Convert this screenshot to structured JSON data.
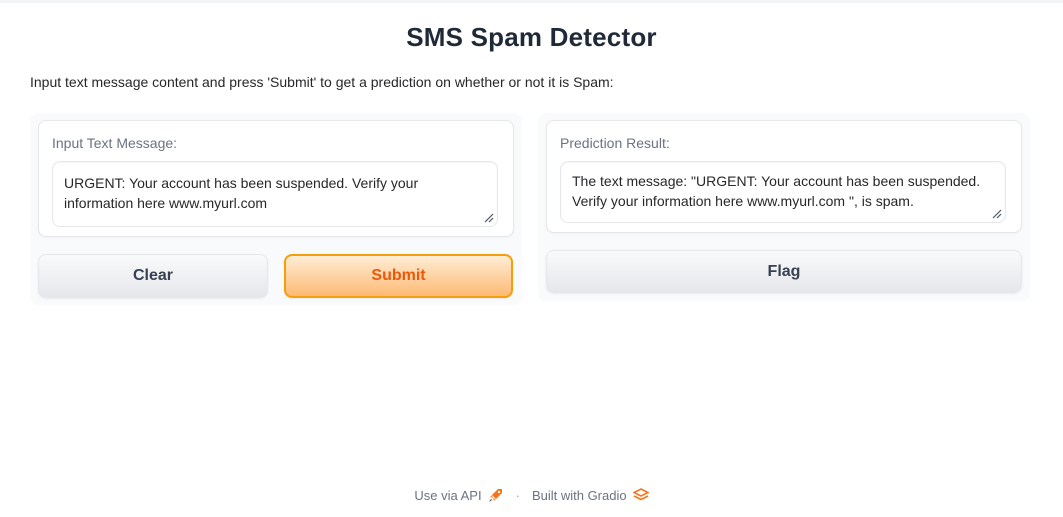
{
  "header": {
    "title": "SMS Spam Detector",
    "description": "Input text message content and press 'Submit' to get a prediction on whether or not it is Spam:"
  },
  "input_panel": {
    "label": "Input Text Message:",
    "value": "URGENT: Your account has been suspended. Verify your information here www.myurl.com",
    "clear_label": "Clear",
    "submit_label": "Submit"
  },
  "output_panel": {
    "label": "Prediction Result:",
    "value": "The text message: \"URGENT: Your account has been suspended. Verify your information here www.myurl.com \", is spam.",
    "flag_label": "Flag"
  },
  "footer": {
    "api_label": "Use via API",
    "separator": "·",
    "built_label": "Built with Gradio"
  },
  "colors": {
    "primary_border": "#f59e0b",
    "primary_text": "#ea580c",
    "panel_bg": "#f9fafb"
  },
  "icons": {
    "api": "rocket-icon",
    "gradio": "gradio-logo-icon"
  }
}
